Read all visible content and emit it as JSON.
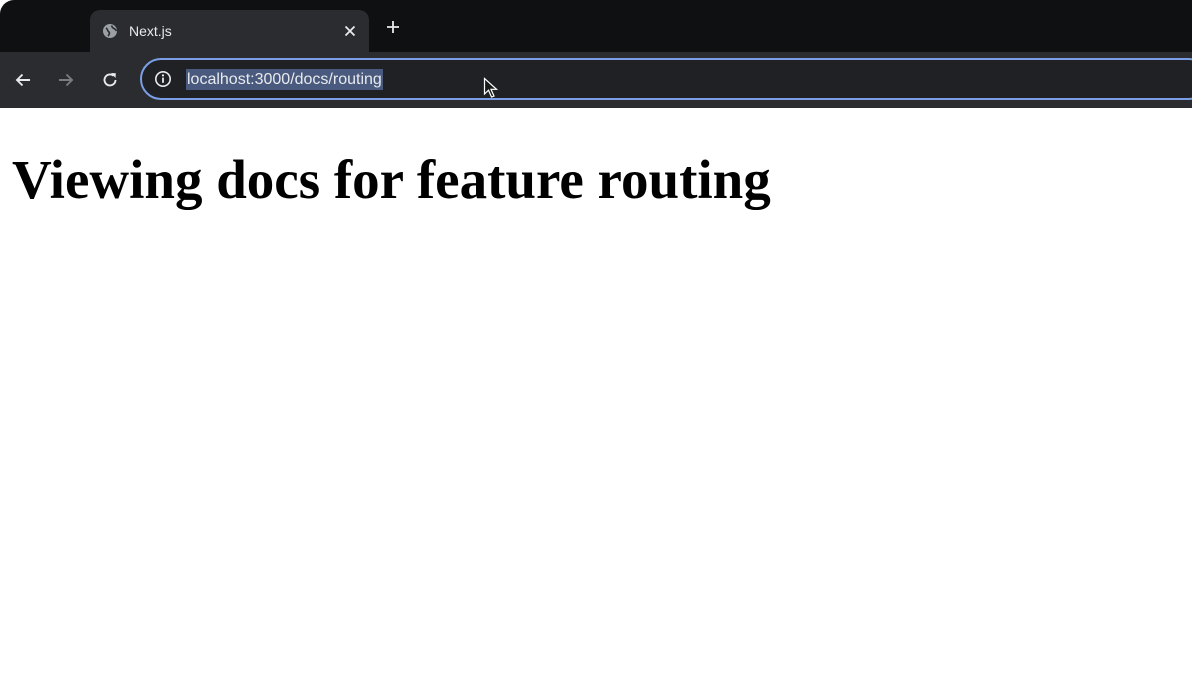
{
  "browser": {
    "tab": {
      "title": "Next.js",
      "favicon": "globe-icon"
    },
    "toolbar": {
      "back": "arrow-left-icon",
      "forward": "arrow-right-icon",
      "reload": "reload-icon"
    },
    "omnibox": {
      "site_info": "info-icon",
      "url": "localhost:3000/docs/routing"
    },
    "colors": {
      "tab_strip": "#0f1011",
      "toolbar": "#2b2c2f",
      "omnibox_border": "#7c9ee6",
      "url_selection": "#4a5a7e"
    }
  },
  "page": {
    "heading": "Viewing docs for feature routing"
  }
}
